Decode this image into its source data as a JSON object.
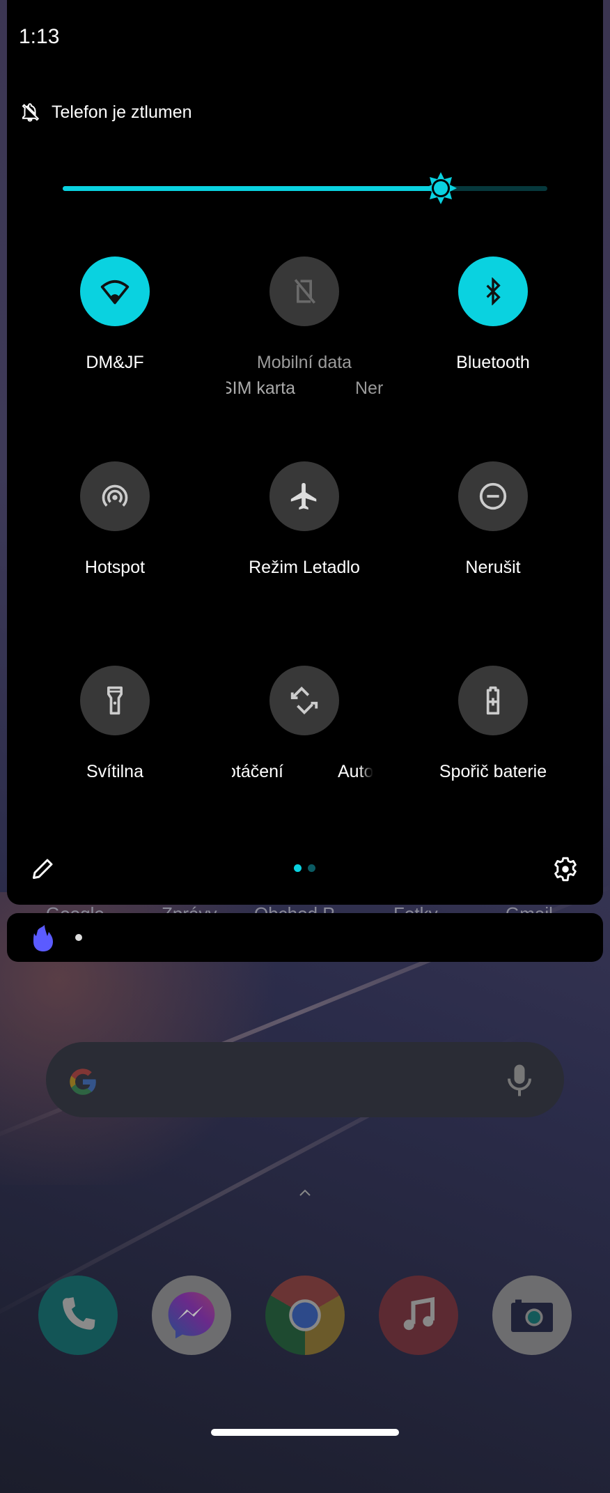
{
  "status_bar": {
    "time": "1:13"
  },
  "quick_settings": {
    "ringer_status": "Telefon je ztlumen",
    "brightness_percent": 78,
    "accent_color": "#0ad2e0",
    "tiles": [
      {
        "label": "DM&JF",
        "icon": "wifi-icon",
        "state": "on"
      },
      {
        "label": "Mobilní data",
        "icon": "no-sim-icon",
        "state": "unavailable",
        "secondary_fragments": [
          "SIM karta",
          "Ner"
        ]
      },
      {
        "label": "Bluetooth",
        "icon": "bluetooth-icon",
        "state": "on"
      },
      {
        "label": "Hotspot",
        "icon": "hotspot-icon",
        "state": "off"
      },
      {
        "label": "Režim Letadlo",
        "icon": "airplane-icon",
        "state": "off"
      },
      {
        "label": "Nerušit",
        "icon": "do-not-disturb-icon",
        "state": "off"
      },
      {
        "label": "Svítilna",
        "icon": "flashlight-icon",
        "state": "off"
      },
      {
        "label_fragments": [
          "otáčení",
          "Auto"
        ],
        "icon": "auto-rotate-icon",
        "state": "off"
      },
      {
        "label": "Spořič baterie",
        "icon": "battery-saver-icon",
        "state": "off"
      }
    ],
    "page_indicator": {
      "pages": 2,
      "current": 1
    },
    "footer": {
      "edit_icon": "pencil-icon",
      "settings_icon": "gear-icon"
    }
  },
  "notification_bar": {
    "icon": "flame-icon",
    "icon_color": "#5b5bff"
  },
  "home": {
    "app_labels_peeking": [
      "Google",
      "Zprávy",
      "Obchod P",
      "Fotky",
      "Gmail"
    ],
    "search_bar": {
      "logo": "google-g-icon",
      "mic": "microphone-icon"
    },
    "dock": [
      {
        "name": "Phone",
        "icon": "phone-icon"
      },
      {
        "name": "Messenger",
        "icon": "messenger-icon"
      },
      {
        "name": "Chrome",
        "icon": "chrome-icon"
      },
      {
        "name": "Music",
        "icon": "music-note-icon"
      },
      {
        "name": "Camera",
        "icon": "camera-icon"
      }
    ]
  }
}
